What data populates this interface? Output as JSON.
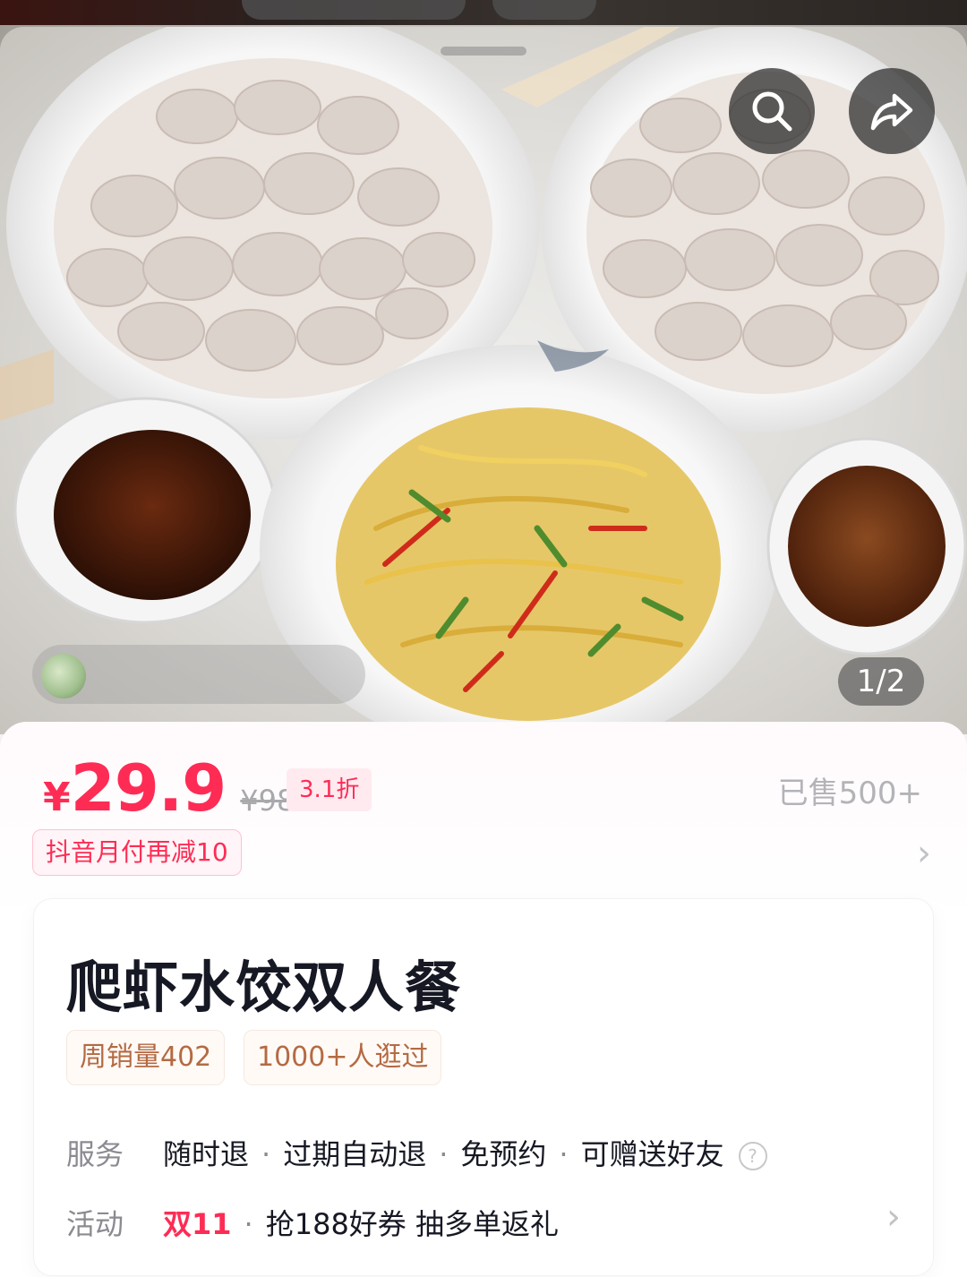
{
  "hero": {
    "page_counter": "1/2",
    "search_icon": "search-icon",
    "share_icon": "share-icon"
  },
  "price": {
    "currency": "¥",
    "current": "29.9",
    "original": "¥98",
    "discount": "3.1折",
    "sold": "已售500+",
    "pay_promo": "抖音月付再减10"
  },
  "product": {
    "title": "爬虾水饺双人餐",
    "stats": [
      "周销量402",
      "1000+人逛过"
    ]
  },
  "service": {
    "label": "服务",
    "items": [
      "随时退",
      "过期自动退",
      "免预约",
      "可赠送好友"
    ],
    "help_icon": "question-icon"
  },
  "activity": {
    "label": "活动",
    "badge": "双11",
    "text": "抢188好券 抽多单返礼"
  },
  "colors": {
    "accent": "#fe2c55",
    "stat_text": "#b46a43"
  }
}
